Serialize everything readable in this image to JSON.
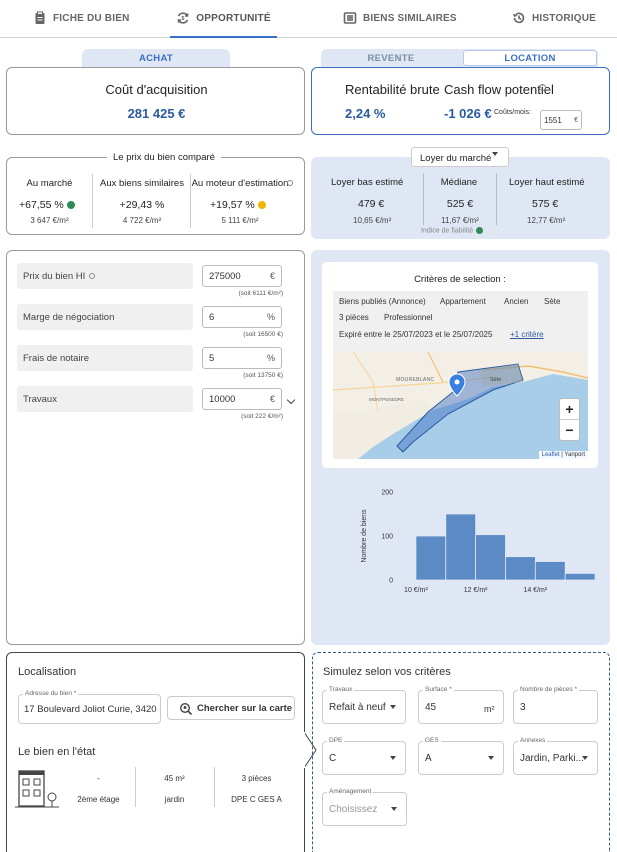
{
  "tabs": [
    {
      "label": "FICHE DU BIEN",
      "icon": "clipboard-icon"
    },
    {
      "label": "OPPORTUNITÉ",
      "icon": "refresh-money-icon"
    },
    {
      "label": "BIENS SIMILAIRES",
      "icon": "list-icon"
    },
    {
      "label": "HISTORIQUE",
      "icon": "history-icon"
    }
  ],
  "left_toggle": {
    "achat": "ACHAT"
  },
  "right_toggle": {
    "revente": "REVENTE",
    "location": "LOCATION"
  },
  "acquisition": {
    "title": "Coût d'acquisition",
    "value": "281 425 €"
  },
  "rentability": {
    "title": "Rentabilité brute",
    "value": "2,24 %",
    "cashflow_title": "Cash flow potentiel",
    "cashflow_value": "-1 026 €",
    "costs_label": "Coûts/mois:",
    "costs_value": "1551",
    "costs_unit": "€"
  },
  "compare": {
    "title": "Le prix du bien comparé",
    "cols": [
      {
        "label": "Au marché",
        "value": "+67,55 %",
        "sub": "3 647 €/m²",
        "dot_color": "#2e8b57"
      },
      {
        "label": "Aux biens similaires",
        "value": "+29,43 %",
        "sub": "4 722 €/m²"
      },
      {
        "label": "Au moteur d'estimation",
        "value": "+19,57 %",
        "sub": "5 111 €/m²",
        "dot_color": "#f0b400"
      }
    ]
  },
  "rent": {
    "dropdown": "Loyer du marché",
    "cols": [
      {
        "label": "Loyer bas estimé",
        "value": "479 €",
        "sub": "10,65 €/m²"
      },
      {
        "label": "Médiane",
        "value": "525 €",
        "sub": "11,67 €/m²"
      },
      {
        "label": "Loyer haut estimé",
        "value": "575 €",
        "sub": "12,77 €/m²"
      }
    ],
    "reliability": "Indice de fiabilité",
    "reliability_color": "#2e8b57"
  },
  "costs": [
    {
      "label": "Prix du bien HI",
      "value": "275000",
      "unit": "€",
      "sub": "(soit 6111 €/m²)"
    },
    {
      "label": "Marge de négociation",
      "value": "6",
      "unit": "%",
      "sub": "(soit 16500 €)"
    },
    {
      "label": "Frais de notaire",
      "value": "5",
      "unit": "%",
      "sub": "(soit 13750 €)"
    },
    {
      "label": "Travaux",
      "value": "10000",
      "unit": "€",
      "sub": "(soit 222 €/m²)"
    }
  ],
  "criteria": {
    "title": "Critères de selection :",
    "row1": [
      "Biens publiés (Annonce)",
      "Appartement",
      "Ancien",
      "Sète"
    ],
    "row2": [
      "3 pièces",
      "Professionnel"
    ],
    "expiry": "Expiré entre le 25/07/2023 et le 25/07/2025",
    "more": "+1 critère"
  },
  "map": {
    "labels": [
      "MOUREBLANC",
      "Sète",
      "MONTPENEDRE"
    ],
    "zoom_in": "+",
    "zoom_out": "−",
    "attribution_link": "Leaflet",
    "attribution_sep": " | ",
    "attribution_text": "Yanport"
  },
  "chart_data": {
    "type": "bar",
    "ylabel": "Nombre de biens",
    "yticks": [
      "0",
      "100",
      "200"
    ],
    "ylim": [
      0,
      200
    ],
    "xticks": [
      "10 €/m²",
      "12 €/m²",
      "14 €/m²"
    ],
    "bins": [
      {
        "x0": 10.0,
        "x1": 11.0,
        "value": 100
      },
      {
        "x0": 11.0,
        "x1": 12.0,
        "value": 150
      },
      {
        "x0": 12.0,
        "x1": 13.0,
        "value": 103
      },
      {
        "x0": 13.0,
        "x1": 14.0,
        "value": 53
      },
      {
        "x0": 14.0,
        "x1": 15.0,
        "value": 42
      },
      {
        "x0": 15.0,
        "x1": 16.0,
        "value": 15
      }
    ],
    "xlim": [
      9.5,
      16.2
    ],
    "color": "#5b8ac4"
  },
  "location": {
    "title": "Localisation",
    "address_label": "Adresse du bien *",
    "address_value": "17 Boulevard Joliot Curie, 3420",
    "search_button": "Chercher sur la carte",
    "state_title": "Le bien en l'état",
    "state": [
      {
        "top": "-",
        "bottom": "2ème étage"
      },
      {
        "top": "45 m²",
        "bottom": "jardin"
      },
      {
        "top": "3 pièces",
        "bottom": "DPE C  GES A"
      }
    ]
  },
  "simulate": {
    "title": "Simulez selon vos critères",
    "fields": [
      {
        "label": "Travaux",
        "value": "Refait à neuf",
        "type": "select"
      },
      {
        "label": "Surface *",
        "value": "45",
        "unit": "m²",
        "type": "input"
      },
      {
        "label": "Nombre de pièces *",
        "value": "3",
        "type": "input"
      },
      {
        "label": "DPE",
        "value": "C",
        "type": "select"
      },
      {
        "label": "GES",
        "value": "A",
        "type": "select"
      },
      {
        "label": "Annexes",
        "value": "Jardin, Parki...",
        "type": "select"
      },
      {
        "label": "Aménagement",
        "value": "Choisissez",
        "type": "select"
      }
    ]
  }
}
